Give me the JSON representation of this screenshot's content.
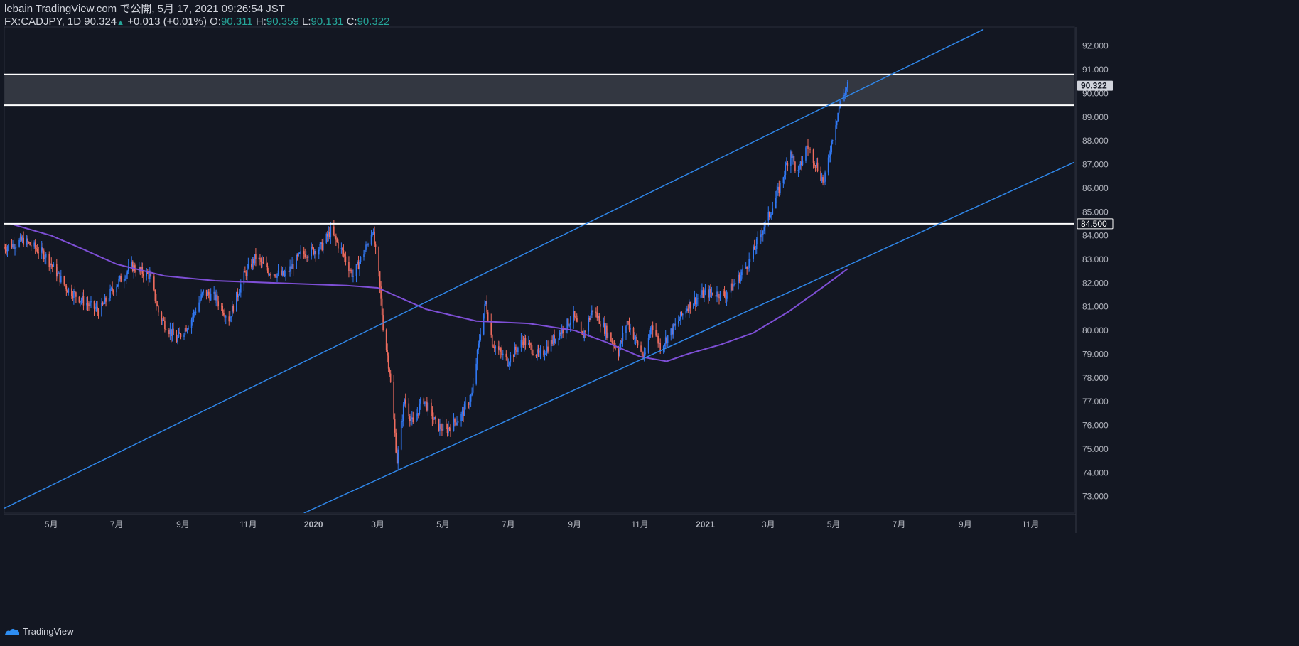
{
  "header": {
    "publish_line": "lebain TradingView.com で公開, 5月 17, 2021 09:26:54 JST",
    "symbol": "FX:CADJPY, 1D",
    "last": "90.324",
    "change": "+0.013 (+0.01%)",
    "o_label": "O:",
    "o_value": "90.311",
    "h_label": "H:",
    "h_value": "90.359",
    "l_label": "L:",
    "l_value": "90.131",
    "c_label": "C:",
    "c_value": "90.322"
  },
  "footer": {
    "brand": "TradingView"
  },
  "colors": {
    "background": "#131722",
    "up": "#3179f5",
    "down": "#ef6c5e",
    "channel": "#2f86e8",
    "ma": "#7e4fd6",
    "level": "#ffffff",
    "zone": "#3a3d47",
    "axis_text": "#b2b5be"
  },
  "chart_data": {
    "type": "candlestick",
    "symbol": "CADJPY",
    "timeframe": "1D",
    "x_tick_labels": [
      "5月",
      "7月",
      "9月",
      "11月",
      "2020",
      "3月",
      "5月",
      "7月",
      "9月",
      "11月",
      "2021",
      "3月",
      "5月",
      "7月",
      "9月",
      "11月"
    ],
    "x_ticks": [
      "2019-05-01",
      "2019-07-01",
      "2019-09-01",
      "2019-11-01",
      "2020-01-01",
      "2020-03-01",
      "2020-05-01",
      "2020-07-01",
      "2020-09-01",
      "2020-11-01",
      "2021-01-01",
      "2021-03-01",
      "2021-05-01",
      "2021-07-01",
      "2021-09-01",
      "2021-11-01"
    ],
    "x_range": [
      "2019-03-18",
      "2021-12-12"
    ],
    "y_range": [
      72.3,
      92.8
    ],
    "y_ticks": [
      73,
      74,
      75,
      76,
      77,
      78,
      79,
      80,
      81,
      82,
      83,
      84,
      85,
      86,
      87,
      88,
      89,
      90,
      91,
      92
    ],
    "y_tick_labels": [
      "73.000",
      "74.000",
      "75.000",
      "76.000",
      "77.000",
      "78.000",
      "79.000",
      "80.000",
      "81.000",
      "82.000",
      "83.000",
      "84.000",
      "85.000",
      "86.000",
      "87.000",
      "88.000",
      "89.000",
      "90.000",
      "91.000",
      "92.000"
    ],
    "price_badges": [
      {
        "label": "90.322",
        "value": 90.322,
        "style": "last"
      },
      {
        "label": "84.500",
        "value": 84.5,
        "style": "level"
      }
    ],
    "price_path": [
      [
        "2019-03-18",
        83.5
      ],
      [
        "2019-04-05",
        83.8
      ],
      [
        "2019-04-25",
        83.2
      ],
      [
        "2019-05-15",
        81.8
      ],
      [
        "2019-06-01",
        81.2
      ],
      [
        "2019-06-15",
        80.8
      ],
      [
        "2019-06-28",
        81.8
      ],
      [
        "2019-07-15",
        82.7
      ],
      [
        "2019-08-01",
        82.3
      ],
      [
        "2019-08-10",
        80.6
      ],
      [
        "2019-08-26",
        79.6
      ],
      [
        "2019-09-08",
        80.4
      ],
      [
        "2019-09-20",
        81.6
      ],
      [
        "2019-10-01",
        81.4
      ],
      [
        "2019-10-14",
        80.5
      ],
      [
        "2019-10-28",
        82.3
      ],
      [
        "2019-11-08",
        83.1
      ],
      [
        "2019-11-20",
        82.5
      ],
      [
        "2019-12-05",
        82.3
      ],
      [
        "2019-12-20",
        83.2
      ],
      [
        "2020-01-08",
        83.5
      ],
      [
        "2020-01-17",
        84.2
      ],
      [
        "2020-01-28",
        83.3
      ],
      [
        "2020-02-07",
        82.3
      ],
      [
        "2020-02-20",
        83.6
      ],
      [
        "2020-02-25",
        84.3
      ],
      [
        "2020-03-02",
        82.3
      ],
      [
        "2020-03-06",
        80.2
      ],
      [
        "2020-03-12",
        78.3
      ],
      [
        "2020-03-16",
        76.2
      ],
      [
        "2020-03-19",
        74.5
      ],
      [
        "2020-03-26",
        77.1
      ],
      [
        "2020-04-03",
        76.0
      ],
      [
        "2020-04-12",
        77.2
      ],
      [
        "2020-04-25",
        76.0
      ],
      [
        "2020-05-04",
        75.8
      ],
      [
        "2020-05-18",
        76.4
      ],
      [
        "2020-05-28",
        77.3
      ],
      [
        "2020-06-05",
        80.0
      ],
      [
        "2020-06-10",
        81.2
      ],
      [
        "2020-06-16",
        79.5
      ],
      [
        "2020-06-30",
        78.7
      ],
      [
        "2020-07-15",
        79.6
      ],
      [
        "2020-07-30",
        78.9
      ],
      [
        "2020-08-12",
        79.6
      ],
      [
        "2020-08-31",
        80.6
      ],
      [
        "2020-09-08",
        79.7
      ],
      [
        "2020-09-18",
        80.9
      ],
      [
        "2020-09-30",
        80.0
      ],
      [
        "2020-10-12",
        79.1
      ],
      [
        "2020-10-20",
        80.4
      ],
      [
        "2020-10-30",
        79.4
      ],
      [
        "2020-11-05",
        78.8
      ],
      [
        "2020-11-12",
        80.3
      ],
      [
        "2020-11-20",
        79.3
      ],
      [
        "2020-12-04",
        80.2
      ],
      [
        "2020-12-15",
        81.0
      ],
      [
        "2020-12-28",
        81.5
      ],
      [
        "2021-01-08",
        81.6
      ],
      [
        "2021-01-20",
        81.5
      ],
      [
        "2021-02-01",
        82.2
      ],
      [
        "2021-02-12",
        83.0
      ],
      [
        "2021-02-24",
        84.3
      ],
      [
        "2021-03-05",
        85.2
      ],
      [
        "2021-03-12",
        86.1
      ],
      [
        "2021-03-22",
        87.6
      ],
      [
        "2021-03-28",
        86.5
      ],
      [
        "2021-04-06",
        87.8
      ],
      [
        "2021-04-14",
        87.1
      ],
      [
        "2021-04-22",
        86.2
      ],
      [
        "2021-04-30",
        88.2
      ],
      [
        "2021-05-07",
        89.6
      ],
      [
        "2021-05-14",
        90.32
      ]
    ],
    "ma_path": [
      [
        "2019-03-24",
        84.5
      ],
      [
        "2019-05-01",
        84.0
      ],
      [
        "2019-06-01",
        83.4
      ],
      [
        "2019-07-01",
        82.8
      ],
      [
        "2019-08-15",
        82.3
      ],
      [
        "2019-10-01",
        82.1
      ],
      [
        "2019-12-01",
        82.0
      ],
      [
        "2020-02-01",
        81.9
      ],
      [
        "2020-03-01",
        81.8
      ],
      [
        "2020-04-15",
        80.9
      ],
      [
        "2020-06-01",
        80.4
      ],
      [
        "2020-07-20",
        80.3
      ],
      [
        "2020-09-01",
        80.0
      ],
      [
        "2020-10-01",
        79.5
      ],
      [
        "2020-11-01",
        78.9
      ],
      [
        "2020-11-26",
        78.7
      ],
      [
        "2020-12-15",
        79.0
      ],
      [
        "2021-01-15",
        79.4
      ],
      [
        "2021-02-15",
        79.9
      ],
      [
        "2021-03-20",
        80.8
      ],
      [
        "2021-04-20",
        81.8
      ],
      [
        "2021-05-14",
        82.6
      ]
    ],
    "horizontal_levels": [
      90.8,
      89.5,
      84.5
    ],
    "zone": [
      89.5,
      90.8
    ],
    "channel_lines": [
      {
        "from": [
          "2019-03-18",
          72.5
        ],
        "to": [
          "2021-09-18",
          92.7
        ]
      },
      {
        "from": [
          "2019-12-23",
          72.3
        ],
        "to": [
          "2021-12-12",
          87.1
        ]
      }
    ]
  }
}
